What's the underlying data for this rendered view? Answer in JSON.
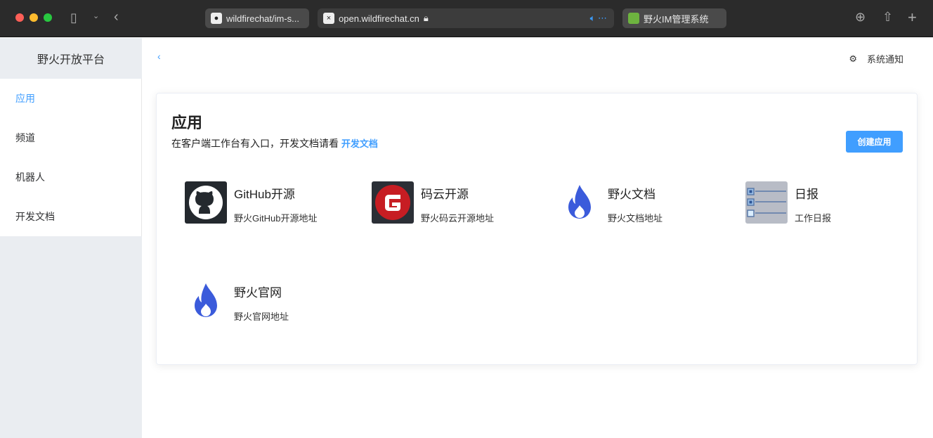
{
  "browser": {
    "tabs": [
      {
        "label": "wildfirechat/im-s..."
      },
      {
        "label": "open.wildfirechat.cn"
      },
      {
        "label": "野火IM管理系统"
      }
    ]
  },
  "sidebar": {
    "title": "野火开放平台",
    "items": [
      {
        "label": "应用",
        "active": true
      },
      {
        "label": "频道"
      },
      {
        "label": "机器人"
      },
      {
        "label": "开发文档"
      }
    ]
  },
  "header": {
    "notice": "系统通知"
  },
  "page": {
    "title": "应用",
    "subtitle": "在客户端工作台有入口，开发文档请看",
    "doc_link": "开发文档",
    "create_button": "创建应用"
  },
  "apps": [
    {
      "name": "GitHub开源",
      "desc": "野火GitHub开源地址",
      "icon": "github-icon"
    },
    {
      "name": "码云开源",
      "desc": "野火码云开源地址",
      "icon": "gitee-icon"
    },
    {
      "name": "野火文档",
      "desc": "野火文档地址",
      "icon": "flame-icon"
    },
    {
      "name": "日报",
      "desc": "工作日报",
      "icon": "checklist-icon"
    },
    {
      "name": "野火官网",
      "desc": "野火官网地址",
      "icon": "flame-icon"
    }
  ],
  "colors": {
    "accent": "#409eff",
    "flame": "#3b5bdb",
    "gitee": "#c71d23"
  }
}
